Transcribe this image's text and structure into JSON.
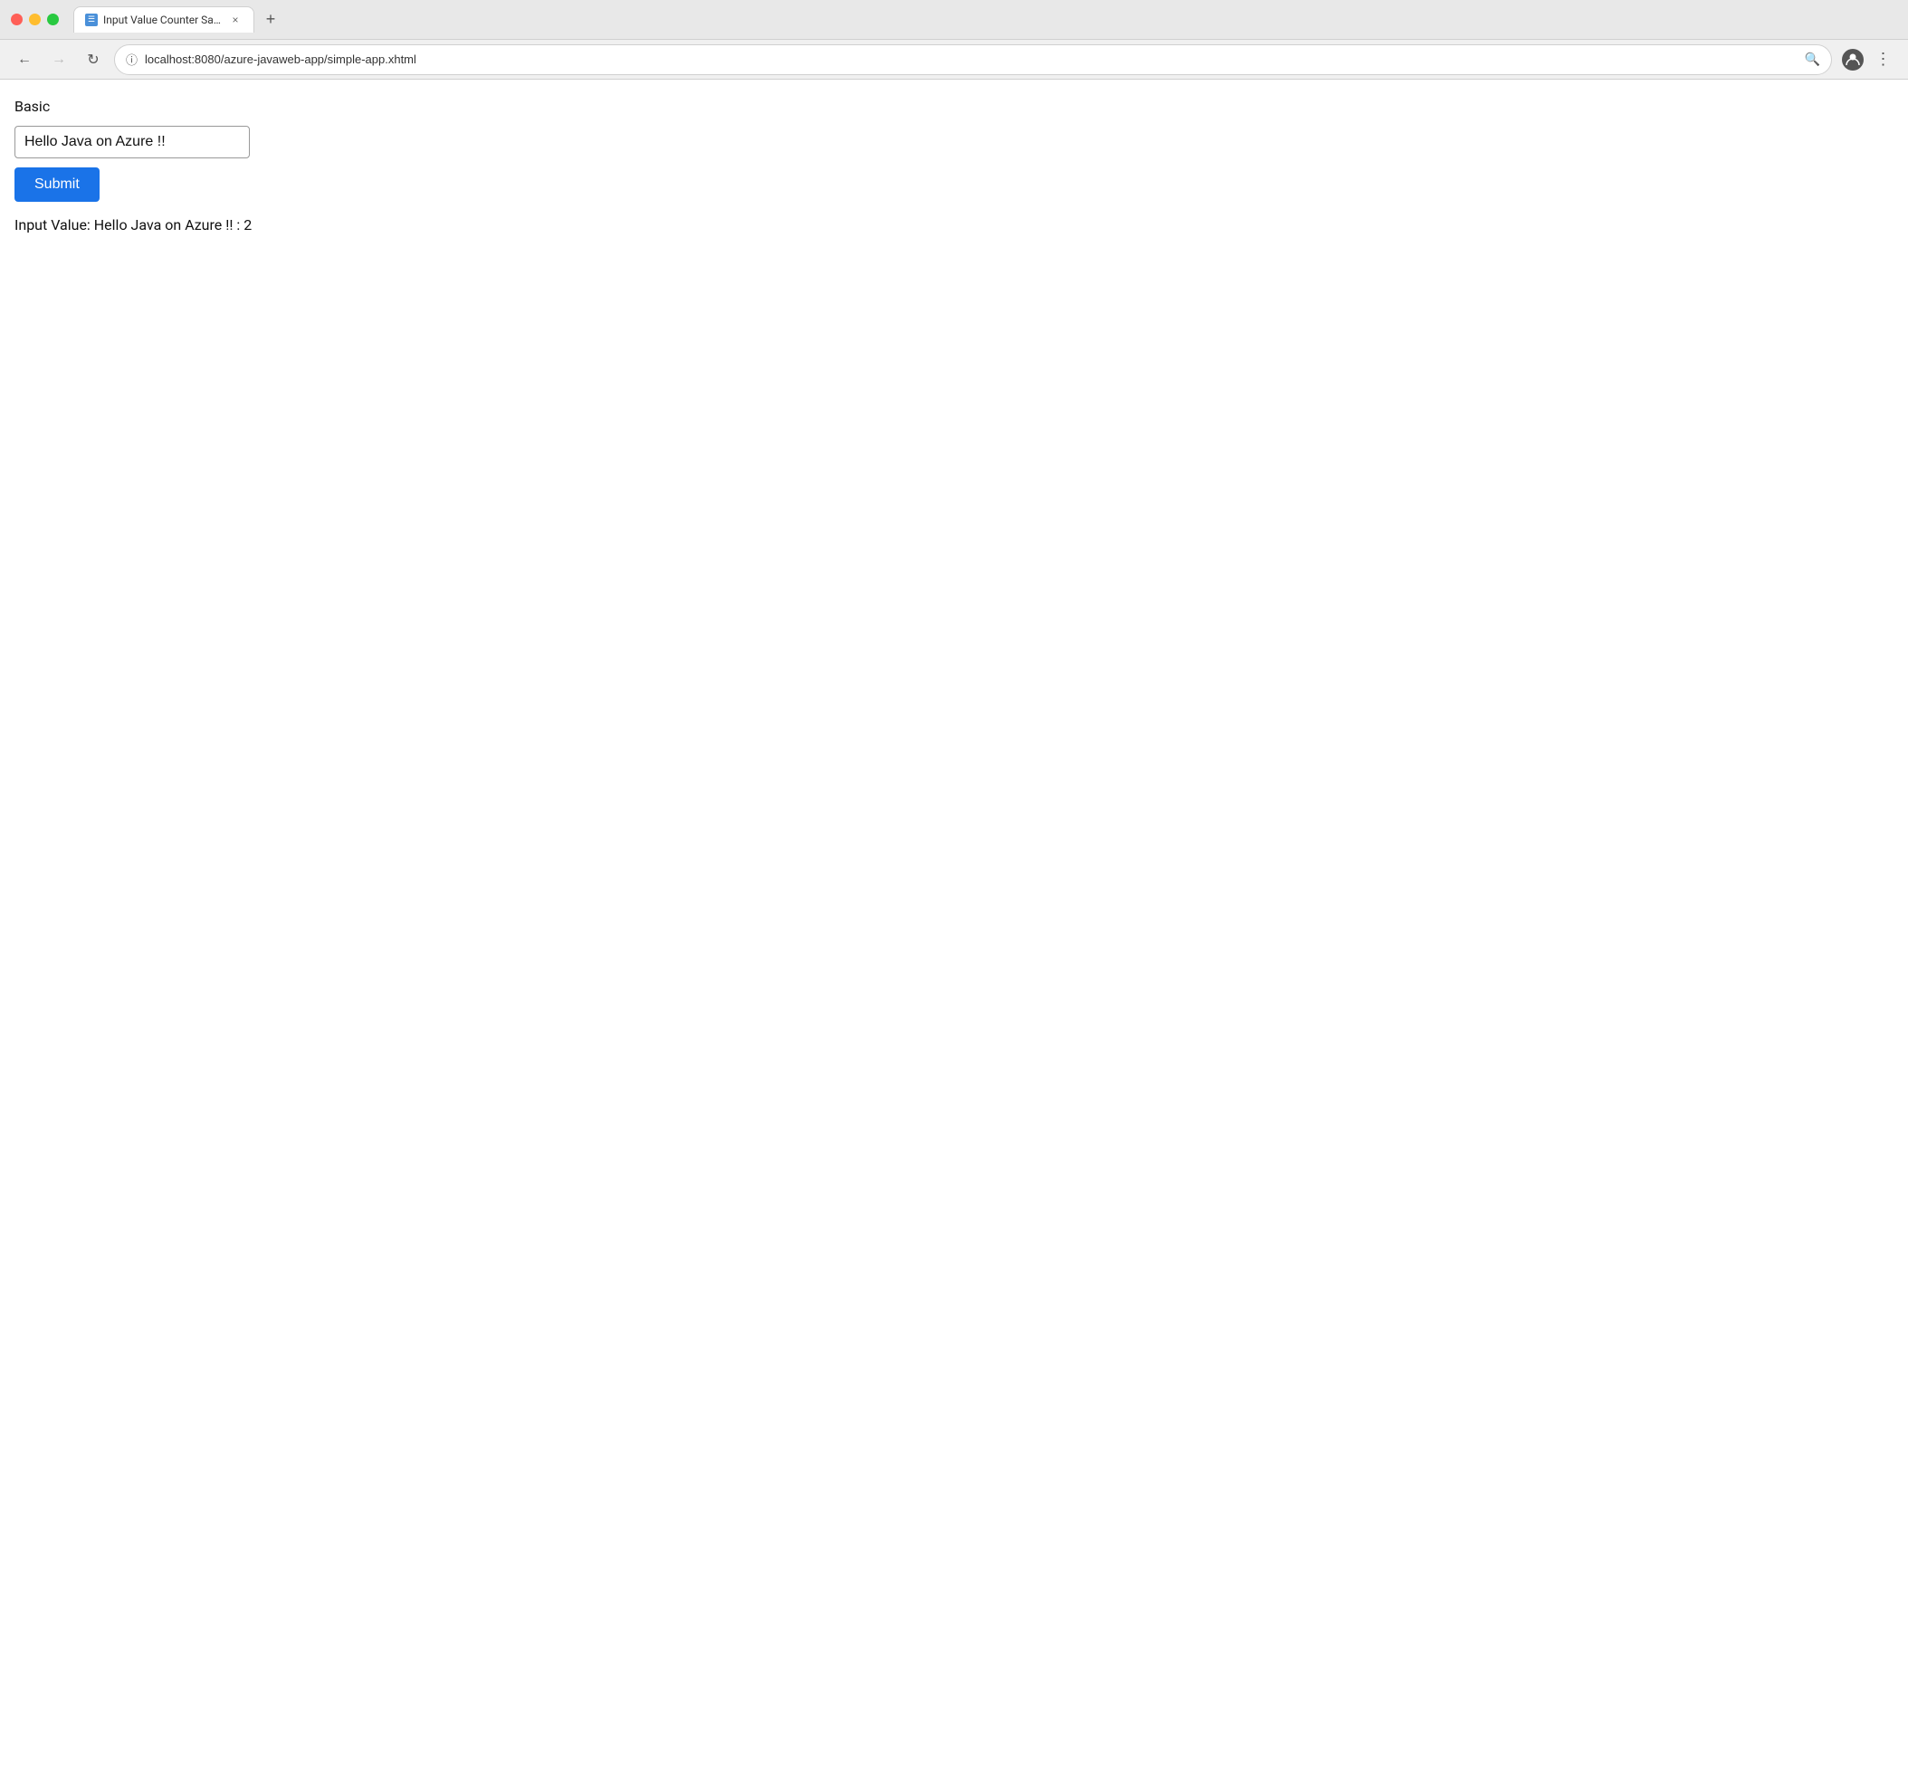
{
  "browser": {
    "tab_title": "Input Value Counter Sample",
    "tab_favicon_text": "☰",
    "tab_close_symbol": "×",
    "new_tab_symbol": "+",
    "nav_back_symbol": "←",
    "nav_forward_symbol": "→",
    "nav_refresh_symbol": "↻",
    "address_bar_url": "localhost:8080/azure-javaweb-app/simple-app.xhtml",
    "search_icon_symbol": "🔍",
    "menu_symbol": "⋮"
  },
  "page": {
    "section_heading": "Basic",
    "input_value": "Hello Java on Azure !!",
    "submit_label": "Submit",
    "result_label": "Input Value: Hello Java on Azure !! : 2"
  }
}
